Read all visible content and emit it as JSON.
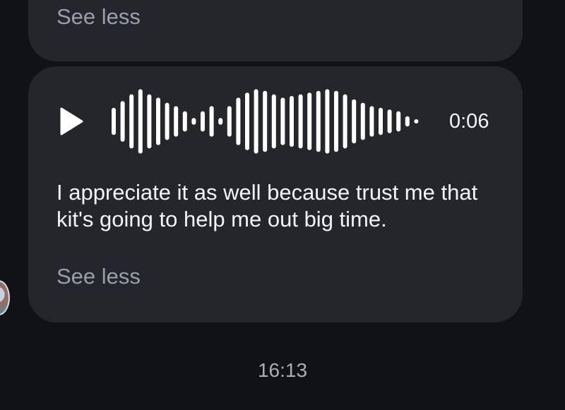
{
  "previous_message": {
    "see_less": "See less"
  },
  "voice_message": {
    "play_icon": "play-icon",
    "duration": "0:06",
    "waveform_levels": [
      0.4,
      0.6,
      0.8,
      0.95,
      0.8,
      0.7,
      0.55,
      0.45,
      0.3,
      0.1,
      0.3,
      0.45,
      0.1,
      0.45,
      0.7,
      0.85,
      0.95,
      0.9,
      0.8,
      0.7,
      0.75,
      0.8,
      0.85,
      0.9,
      0.95,
      0.9,
      0.8,
      0.65,
      0.55,
      0.45,
      0.4,
      0.35,
      0.3,
      0.15,
      0.05
    ],
    "transcript": "I appreciate it as well because trust me that kit's going to help me out big time.",
    "see_less": "See less"
  },
  "timestamp": "16:13",
  "colors": {
    "background": "#111216",
    "bubble": "#25262b",
    "text": "#f4f4f6",
    "muted": "#9aa0ab"
  }
}
